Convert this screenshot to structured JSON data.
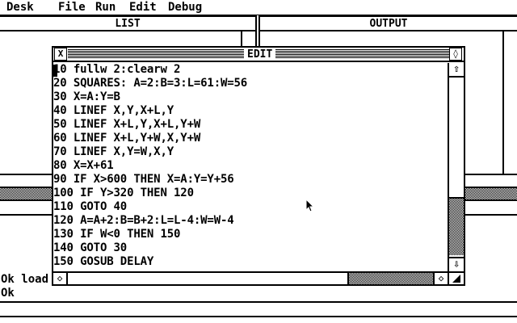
{
  "menu": {
    "items": [
      "Desk",
      "File",
      "Run",
      "Edit",
      "Debug"
    ]
  },
  "list_window": {
    "title": "LIST"
  },
  "output_window": {
    "title": "OUTPUT"
  },
  "edit_window": {
    "title": "EDIT",
    "close_glyph": "X",
    "fuller_glyph": "◊",
    "up_glyph": "⇧",
    "down_glyph": "⇩",
    "left_glyph": "◇",
    "right_glyph": "◇",
    "lines": [
      "10 fullw 2:clearw 2",
      "20 SQUARES: A=2:B=3:L=61:W=56",
      "30 X=A:Y=B",
      "40 LINEF X,Y,X+L,Y",
      "50 LINEF X+L,Y,X+L,Y+W",
      "60 LINEF X+L,Y+W,X,Y+W",
      "70 LINEF X,Y=W,X,Y",
      "80 X=X+61",
      "90 IF X>600 THEN X=A:Y=Y+56",
      "100 IF Y>320 THEN 120",
      "110 GOTO 40",
      "120 A=A+2:B=B+2:L=L-4:W=W-4",
      "130 IF W<0 THEN 150",
      "140 GOTO 30",
      "150 GOSUB DELAY"
    ]
  },
  "command_window": {
    "lines": [
      "Ok load",
      "Ok"
    ]
  }
}
